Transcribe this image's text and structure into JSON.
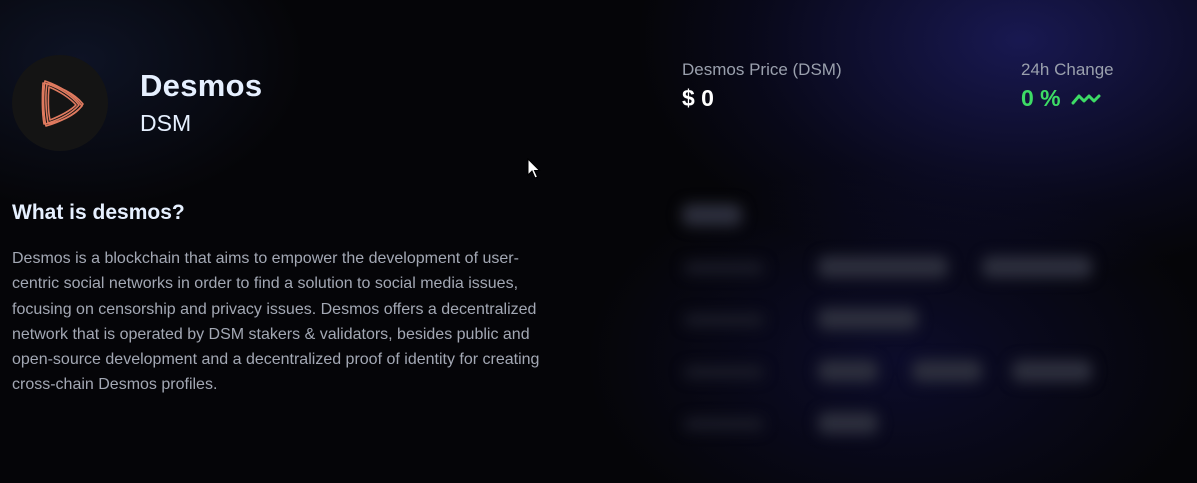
{
  "coin": {
    "name": "Desmos",
    "symbol": "DSM",
    "logo_icon": "desmos-logo-icon"
  },
  "stats": {
    "price_label": "Desmos Price (DSM)",
    "price_value": "$ 0",
    "change_label": "24h Change",
    "change_value": "0 %",
    "change_icon": "trend-up-icon",
    "change_color": "#3ddc65"
  },
  "about": {
    "title": "What is desmos?",
    "description": "Desmos is a blockchain that aims to empower the development of user-centric social networks in order to find a solution to social media issues, focusing on censorship and privacy issues. Desmos offers a decentralized network that is operated by DSM stakers & validators, besides public and open-source development and a decentralized proof of identity for creating cross-chain Desmos profiles."
  },
  "colors": {
    "background": "#050508",
    "heading": "#e6f0ff",
    "body_text": "#a3a8b4",
    "logo_stroke": "#e07a5f"
  }
}
